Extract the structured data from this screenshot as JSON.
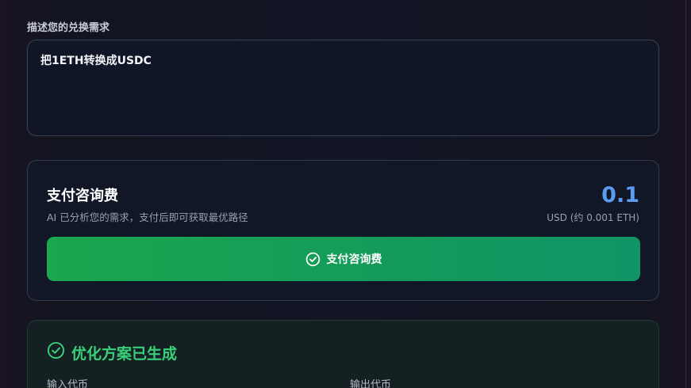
{
  "form": {
    "request_label": "描述您的兑换需求",
    "request_value": "把1ETH转换成USDC"
  },
  "fee_card": {
    "title": "支付咨询费",
    "subtitle": "AI 已分析您的需求，支付后即可获取最优路径",
    "amount": "0.1",
    "unit": "USD (约 0.001 ETH)",
    "pay_button_label": "支付咨询费",
    "pay_button_icon": "check-circle-icon"
  },
  "result_card": {
    "title": "优化方案已生成",
    "title_icon": "check-circle-icon",
    "input_token_label": "输入代币",
    "output_token_label": "输出代币"
  },
  "colors": {
    "accent_blue": "#5b9cf5",
    "success_green": "#38d07a",
    "button_green": "#1aa74e"
  }
}
